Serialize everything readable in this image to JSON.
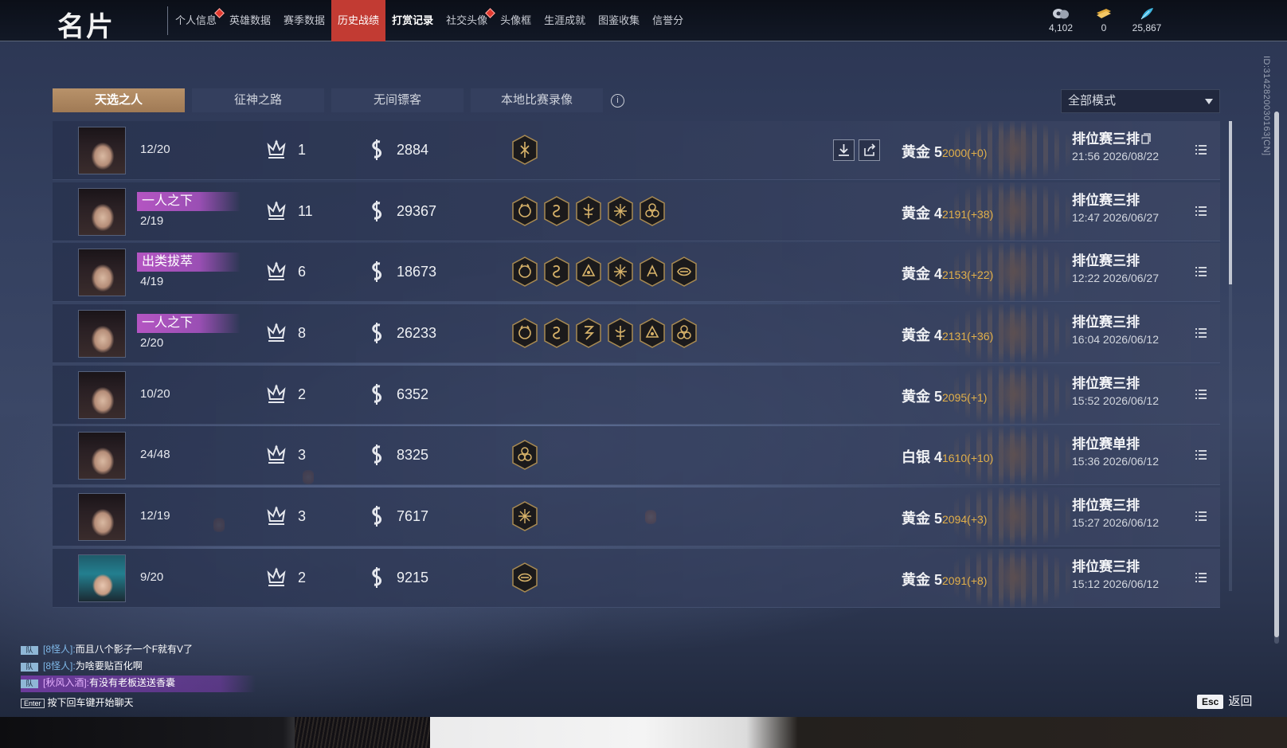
{
  "header": {
    "title": "名片",
    "nav": [
      {
        "label": "个人信息",
        "badge": true
      },
      {
        "label": "英雄数据",
        "badge": false
      },
      {
        "label": "赛季数据",
        "badge": false
      },
      {
        "label": "历史战绩",
        "badge": false,
        "active": true
      },
      {
        "label": "打赏记录",
        "badge": false,
        "bold": true
      },
      {
        "label": "社交头像",
        "badge": true
      },
      {
        "label": "头像框",
        "badge": false
      },
      {
        "label": "生涯成就",
        "badge": false
      },
      {
        "label": "图鉴收集",
        "badge": false
      },
      {
        "label": "信誉分",
        "badge": false
      }
    ],
    "currencies": [
      {
        "icon": "eye-coin-icon",
        "value": "4,102"
      },
      {
        "icon": "ticket-icon",
        "value": "0"
      },
      {
        "icon": "feather-icon",
        "value": "25,867"
      }
    ]
  },
  "side_id": "ID:3142820030163[CN]",
  "tabs": [
    "天选之人",
    "征神之路",
    "无间镖客",
    "本地比赛录像"
  ],
  "mode_select": {
    "value": "全部模式"
  },
  "matches": [
    {
      "title": "",
      "kda": "12/20",
      "rank": "1",
      "score": "2884",
      "achievements": [
        "ach-a"
      ],
      "tier": "黄金 5",
      "points": "2000(+0)",
      "type": "排位赛三排",
      "time": "21:56  2026/08/22",
      "has_replay": true,
      "avatar": "a"
    },
    {
      "title": "一人之下",
      "kda": "2/19",
      "rank": "11",
      "score": "29367",
      "achievements": [
        "ach-b",
        "ach-c",
        "ach-d",
        "ach-e",
        "ach-f"
      ],
      "tier": "黄金 4",
      "points": "2191(+38)",
      "type": "排位赛三排",
      "time": "12:47  2026/06/27",
      "has_replay": false,
      "avatar": "a"
    },
    {
      "title": "出类拔萃",
      "kda": "4/19",
      "rank": "6",
      "score": "18673",
      "achievements": [
        "ach-b",
        "ach-c",
        "ach-g",
        "ach-e",
        "ach-h",
        "ach-i"
      ],
      "tier": "黄金 4",
      "points": "2153(+22)",
      "type": "排位赛三排",
      "time": "12:22  2026/06/27",
      "has_replay": false,
      "avatar": "a"
    },
    {
      "title": "一人之下",
      "kda": "2/20",
      "rank": "8",
      "score": "26233",
      "achievements": [
        "ach-b",
        "ach-c",
        "ach-j",
        "ach-d",
        "ach-g",
        "ach-f"
      ],
      "tier": "黄金 4",
      "points": "2131(+36)",
      "type": "排位赛三排",
      "time": "16:04  2026/06/12",
      "has_replay": false,
      "avatar": "a"
    },
    {
      "title": "",
      "kda": "10/20",
      "rank": "2",
      "score": "6352",
      "achievements": [],
      "tier": "黄金 5",
      "points": "2095(+1)",
      "type": "排位赛三排",
      "time": "15:52  2026/06/12",
      "has_replay": false,
      "avatar": "a"
    },
    {
      "title": "",
      "kda": "24/48",
      "rank": "3",
      "score": "8325",
      "achievements": [
        "ach-f"
      ],
      "tier": "白银 4",
      "points": "1610(+10)",
      "type": "排位赛单排",
      "time": "15:36  2026/06/12",
      "has_replay": false,
      "avatar": "a"
    },
    {
      "title": "",
      "kda": "12/19",
      "rank": "3",
      "score": "7617",
      "achievements": [
        "ach-e"
      ],
      "tier": "黄金 5",
      "points": "2094(+3)",
      "type": "排位赛三排",
      "time": "15:27  2026/06/12",
      "has_replay": false,
      "avatar": "a"
    },
    {
      "title": "",
      "kda": "9/20",
      "rank": "2",
      "score": "9215",
      "achievements": [
        "ach-i"
      ],
      "tier": "黄金 5",
      "points": "2091(+8)",
      "type": "排位赛三排",
      "time": "15:12  2026/06/12",
      "has_replay": false,
      "avatar": "alt"
    }
  ],
  "chat": {
    "lines": [
      {
        "tag": "队",
        "name": "[8怪人]:",
        "msg": "而且八个影子一个F就有V了",
        "highlight": false
      },
      {
        "tag": "队",
        "name": "[8怪人]:",
        "msg": "为啥要贴百化啊",
        "highlight": false
      },
      {
        "tag": "队",
        "name": "[秋风入酒]:",
        "msg": "有没有老板送送香囊",
        "highlight": true
      }
    ],
    "enter_key": "Enter",
    "hint": "按下回车键开始聊天"
  },
  "footer": {
    "esc_key": "Esc",
    "back_label": "返回"
  },
  "colors": {
    "accent_red": "#c23b33",
    "tab_active": "#b8926a",
    "title_purple": "#b455c2",
    "points_gold": "#e2b04a"
  }
}
